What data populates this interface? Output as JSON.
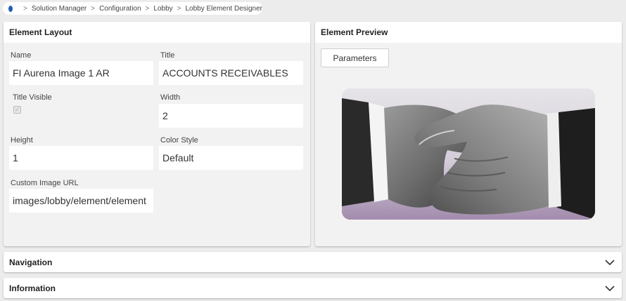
{
  "breadcrumb": {
    "items": [
      "Solution Manager",
      "Configuration",
      "Lobby",
      "Lobby Element Designer"
    ],
    "separator": ">"
  },
  "element_layout": {
    "title": "Element Layout",
    "fields": {
      "name": {
        "label": "Name",
        "value": "FI Aurena Image 1 AR"
      },
      "title": {
        "label": "Title",
        "value": "ACCOUNTS RECEIVABLES"
      },
      "title_visible": {
        "label": "Title Visible",
        "checked": true,
        "disabled": true
      },
      "width": {
        "label": "Width",
        "value": "2"
      },
      "height": {
        "label": "Height",
        "value": "1"
      },
      "color_style": {
        "label": "Color Style",
        "value": "Default"
      },
      "custom_image_url": {
        "label": "Custom Image URL",
        "value": "images/lobby/element/element"
      }
    }
  },
  "element_preview": {
    "title": "Element Preview",
    "parameters_button": "Parameters",
    "image": "handshake-photo"
  },
  "sections": {
    "navigation": {
      "title": "Navigation",
      "expanded": false
    },
    "information": {
      "title": "Information",
      "expanded": false
    }
  },
  "colors": {
    "accent": "#1f5fb8",
    "card_background": "#f2f2f2",
    "page_background": "#ececec"
  }
}
